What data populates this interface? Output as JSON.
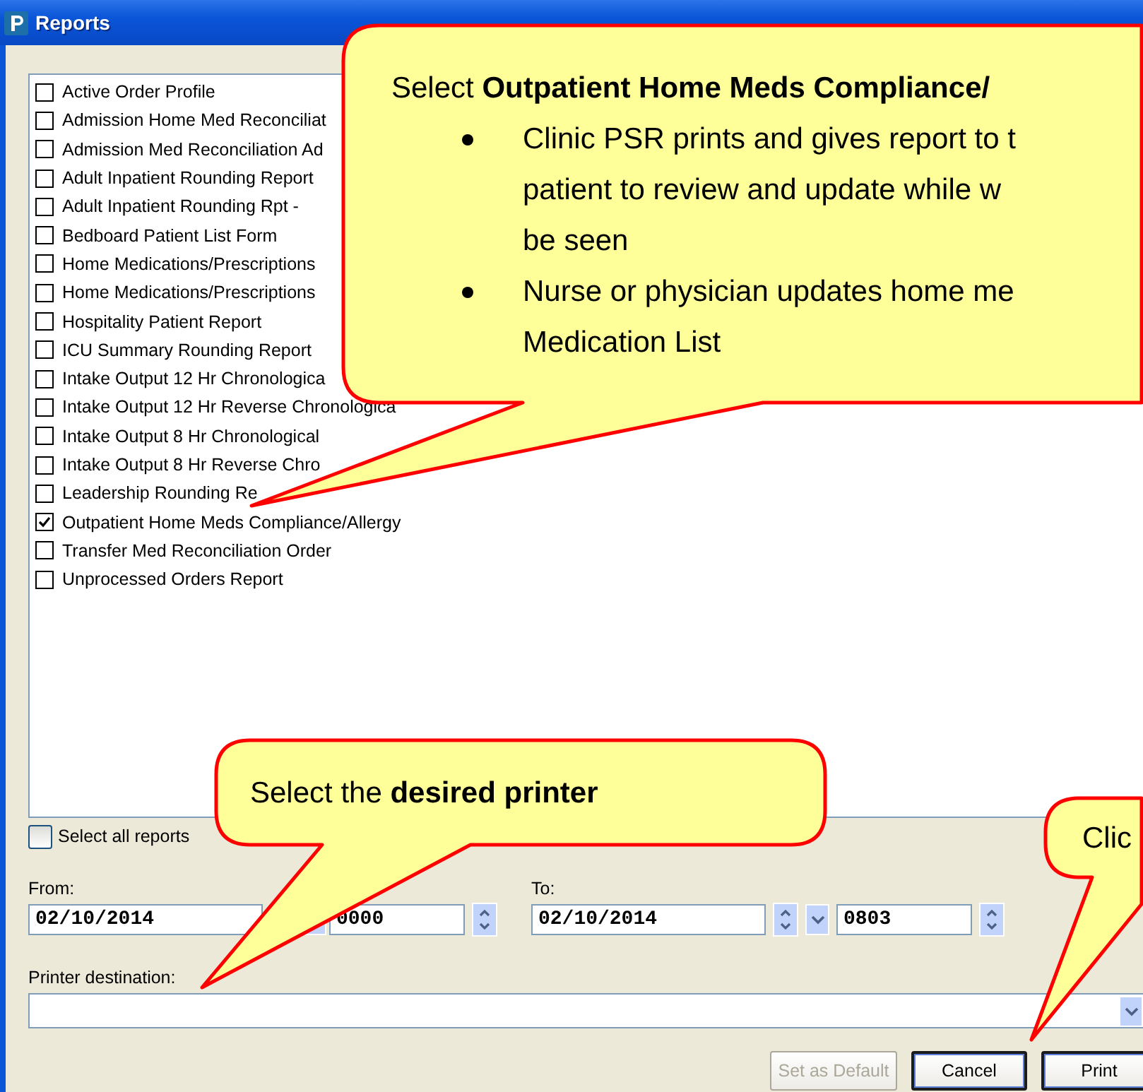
{
  "window": {
    "title": "Reports"
  },
  "reports": [
    {
      "label": "Active Order Profile",
      "checked": false
    },
    {
      "label": "Admission Home Med Reconciliat",
      "checked": false
    },
    {
      "label": "Admission Med Reconciliation Ad",
      "checked": false
    },
    {
      "label": "Adult Inpatient Rounding Report",
      "checked": false
    },
    {
      "label": "Adult Inpatient Rounding Rpt -",
      "checked": false
    },
    {
      "label": "Bedboard Patient List Form",
      "checked": false
    },
    {
      "label": "Home Medications/Prescriptions",
      "checked": false
    },
    {
      "label": "Home Medications/Prescriptions",
      "checked": false
    },
    {
      "label": "Hospitality Patient Report",
      "checked": false
    },
    {
      "label": "ICU Summary Rounding Report",
      "checked": false
    },
    {
      "label": "Intake Output 12 Hr Chronologica",
      "checked": false
    },
    {
      "label": "Intake Output 12 Hr Reverse Chronologica",
      "checked": false
    },
    {
      "label": "Intake Output 8 Hr Chronological",
      "checked": false
    },
    {
      "label": "Intake Output 8 Hr Reverse Chro",
      "checked": false
    },
    {
      "label": "Leadership Rounding Re",
      "checked": false
    },
    {
      "label": "Outpatient Home Meds Compliance/Allergy",
      "checked": true
    },
    {
      "label": "Transfer Med Reconciliation Order",
      "checked": false
    },
    {
      "label": "Unprocessed Orders Report",
      "checked": false
    }
  ],
  "select_all": {
    "label": "Select all reports",
    "checked": false
  },
  "from": {
    "label": "From:",
    "date": "02/10/2014",
    "time": "0000"
  },
  "to": {
    "label": "To:",
    "date": "02/10/2014",
    "time": "0803"
  },
  "printer": {
    "label": "Printer destination:"
  },
  "buttons": [
    {
      "label": "Set as Default",
      "disabled": true
    },
    {
      "label": "Cancel",
      "disabled": false
    },
    {
      "label": "Print",
      "disabled": false
    }
  ],
  "callouts": [
    {
      "kind": "main",
      "title": "Select **Outpatient Home Meds Compliance/**",
      "bullets": [
        [
          "Clinic PSR prints and gives report to t",
          "patient to review and update while w",
          "be seen"
        ],
        [
          "Nurse or physician updates home me",
          "Medication List"
        ]
      ]
    },
    {
      "kind": "printer",
      "text": "Select the **desired printer**"
    },
    {
      "kind": "button",
      "text": "Clic"
    }
  ]
}
